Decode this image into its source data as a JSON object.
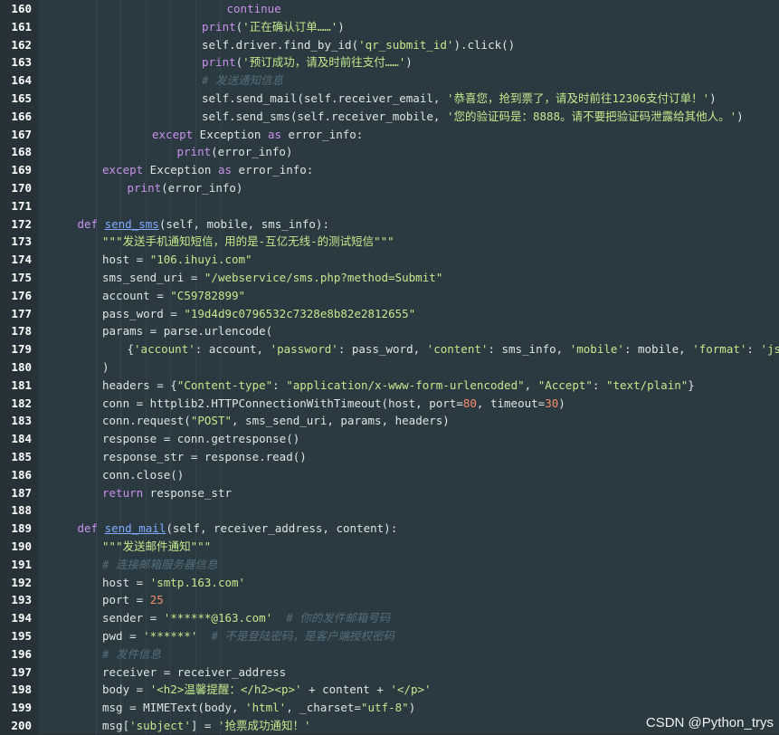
{
  "watermark": "CSDN @Python_trys",
  "lines": [
    {
      "n": "160",
      "indent": 7,
      "tokens": [
        [
          "kw",
          "continue"
        ]
      ]
    },
    {
      "n": "161",
      "indent": 6,
      "tokens": [
        [
          "bi",
          "print"
        ],
        [
          "plain",
          "("
        ],
        [
          "str",
          "'正在确认订单……'"
        ],
        [
          "plain",
          ")"
        ]
      ]
    },
    {
      "n": "162",
      "indent": 6,
      "tokens": [
        [
          "plain",
          "self.driver.find_by_id("
        ],
        [
          "str",
          "'qr_submit_id'"
        ],
        [
          "plain",
          ").click()"
        ]
      ]
    },
    {
      "n": "163",
      "indent": 6,
      "tokens": [
        [
          "bi",
          "print"
        ],
        [
          "plain",
          "("
        ],
        [
          "str",
          "'预订成功，请及时前往支付……'"
        ],
        [
          "plain",
          ")"
        ]
      ]
    },
    {
      "n": "164",
      "indent": 6,
      "tokens": [
        [
          "com",
          "# 发送通知信息"
        ]
      ]
    },
    {
      "n": "165",
      "indent": 6,
      "tokens": [
        [
          "plain",
          "self.send_mail(self.receiver_email, "
        ],
        [
          "str",
          "'恭喜您，抢到票了，请及时前往12306支付订单！'"
        ],
        [
          "plain",
          ")"
        ]
      ]
    },
    {
      "n": "166",
      "indent": 6,
      "tokens": [
        [
          "plain",
          "self.send_sms(self.receiver_mobile, "
        ],
        [
          "str",
          "'您的验证码是：8888。请不要把验证码泄露给其他人。'"
        ],
        [
          "plain",
          ")"
        ]
      ]
    },
    {
      "n": "167",
      "indent": 4,
      "tokens": [
        [
          "kw",
          "except"
        ],
        [
          "plain",
          " Exception "
        ],
        [
          "kw",
          "as"
        ],
        [
          "plain",
          " error_info:"
        ]
      ]
    },
    {
      "n": "168",
      "indent": 5,
      "tokens": [
        [
          "bi",
          "print"
        ],
        [
          "plain",
          "(error_info)"
        ]
      ]
    },
    {
      "n": "169",
      "indent": 2,
      "tokens": [
        [
          "kw",
          "except"
        ],
        [
          "plain",
          " Exception "
        ],
        [
          "kw",
          "as"
        ],
        [
          "plain",
          " error_info:"
        ]
      ]
    },
    {
      "n": "170",
      "indent": 3,
      "tokens": [
        [
          "bi",
          "print"
        ],
        [
          "plain",
          "(error_info)"
        ]
      ]
    },
    {
      "n": "171",
      "indent": 0,
      "tokens": []
    },
    {
      "n": "172",
      "indent": 1,
      "tokens": [
        [
          "kw",
          "def"
        ],
        [
          "plain",
          " "
        ],
        [
          "fn",
          "send_sms"
        ],
        [
          "plain",
          "(self, mobile, sms_info):"
        ]
      ]
    },
    {
      "n": "173",
      "indent": 2,
      "tokens": [
        [
          "str",
          "\"\"\"发送手机通知短信，用的是-互亿无线-的测试短信\"\"\""
        ]
      ]
    },
    {
      "n": "174",
      "indent": 2,
      "tokens": [
        [
          "plain",
          "host = "
        ],
        [
          "str",
          "\"106.ihuyi.com\""
        ]
      ]
    },
    {
      "n": "175",
      "indent": 2,
      "tokens": [
        [
          "plain",
          "sms_send_uri = "
        ],
        [
          "str",
          "\"/webservice/sms.php?method=Submit\""
        ]
      ]
    },
    {
      "n": "176",
      "indent": 2,
      "tokens": [
        [
          "plain",
          "account = "
        ],
        [
          "str",
          "\"C59782899\""
        ]
      ]
    },
    {
      "n": "177",
      "indent": 2,
      "tokens": [
        [
          "plain",
          "pass_word = "
        ],
        [
          "str",
          "\"19d4d9c0796532c7328e8b82e2812655\""
        ]
      ]
    },
    {
      "n": "178",
      "indent": 2,
      "tokens": [
        [
          "plain",
          "params = parse.urlencode("
        ]
      ]
    },
    {
      "n": "179",
      "indent": 3,
      "tokens": [
        [
          "plain",
          "{"
        ],
        [
          "str",
          "'account'"
        ],
        [
          "plain",
          ": account, "
        ],
        [
          "str",
          "'password'"
        ],
        [
          "plain",
          ": pass_word, "
        ],
        [
          "str",
          "'content'"
        ],
        [
          "plain",
          ": sms_info, "
        ],
        [
          "str",
          "'mobile'"
        ],
        [
          "plain",
          ": mobile, "
        ],
        [
          "str",
          "'format'"
        ],
        [
          "plain",
          ": "
        ],
        [
          "str",
          "'json'"
        ],
        [
          "plain",
          "}"
        ]
      ]
    },
    {
      "n": "180",
      "indent": 2,
      "tokens": [
        [
          "plain",
          ")"
        ]
      ]
    },
    {
      "n": "181",
      "indent": 2,
      "tokens": [
        [
          "plain",
          "headers = {"
        ],
        [
          "str",
          "\"Content-type\""
        ],
        [
          "plain",
          ": "
        ],
        [
          "str",
          "\"application/x-www-form-urlencoded\""
        ],
        [
          "plain",
          ", "
        ],
        [
          "str",
          "\"Accept\""
        ],
        [
          "plain",
          ": "
        ],
        [
          "str",
          "\"text/plain\""
        ],
        [
          "plain",
          "}"
        ]
      ]
    },
    {
      "n": "182",
      "indent": 2,
      "tokens": [
        [
          "plain",
          "conn = httplib2.HTTPConnectionWithTimeout(host, port="
        ],
        [
          "num",
          "80"
        ],
        [
          "plain",
          ", timeout="
        ],
        [
          "num",
          "30"
        ],
        [
          "plain",
          ")"
        ]
      ]
    },
    {
      "n": "183",
      "indent": 2,
      "tokens": [
        [
          "plain",
          "conn.request("
        ],
        [
          "str",
          "\"POST\""
        ],
        [
          "plain",
          ", sms_send_uri, params, headers)"
        ]
      ]
    },
    {
      "n": "184",
      "indent": 2,
      "tokens": [
        [
          "plain",
          "response = conn.getresponse()"
        ]
      ]
    },
    {
      "n": "185",
      "indent": 2,
      "tokens": [
        [
          "plain",
          "response_str = response.read()"
        ]
      ]
    },
    {
      "n": "186",
      "indent": 2,
      "tokens": [
        [
          "plain",
          "conn.close()"
        ]
      ]
    },
    {
      "n": "187",
      "indent": 2,
      "tokens": [
        [
          "kw",
          "return"
        ],
        [
          "plain",
          " response_str"
        ]
      ]
    },
    {
      "n": "188",
      "indent": 0,
      "tokens": []
    },
    {
      "n": "189",
      "indent": 1,
      "tokens": [
        [
          "kw",
          "def"
        ],
        [
          "plain",
          " "
        ],
        [
          "fn",
          "send_mail"
        ],
        [
          "plain",
          "(self, receiver_address, content):"
        ]
      ]
    },
    {
      "n": "190",
      "indent": 2,
      "tokens": [
        [
          "str",
          "\"\"\"发送邮件通知\"\"\""
        ]
      ]
    },
    {
      "n": "191",
      "indent": 2,
      "tokens": [
        [
          "com",
          "# 连接邮箱服务器信息"
        ]
      ]
    },
    {
      "n": "192",
      "indent": 2,
      "tokens": [
        [
          "plain",
          "host = "
        ],
        [
          "str",
          "'smtp.163.com'"
        ]
      ]
    },
    {
      "n": "193",
      "indent": 2,
      "tokens": [
        [
          "plain",
          "port = "
        ],
        [
          "num",
          "25"
        ]
      ]
    },
    {
      "n": "194",
      "indent": 2,
      "tokens": [
        [
          "plain",
          "sender = "
        ],
        [
          "str",
          "'******@163.com'"
        ],
        [
          "plain",
          "  "
        ],
        [
          "com",
          "# 你的发件邮箱号码"
        ]
      ]
    },
    {
      "n": "195",
      "indent": 2,
      "tokens": [
        [
          "plain",
          "pwd = "
        ],
        [
          "str",
          "'******'"
        ],
        [
          "plain",
          "  "
        ],
        [
          "com",
          "# 不是登陆密码，是客户端授权密码"
        ]
      ]
    },
    {
      "n": "196",
      "indent": 2,
      "tokens": [
        [
          "com",
          "# 发件信息"
        ]
      ]
    },
    {
      "n": "197",
      "indent": 2,
      "tokens": [
        [
          "plain",
          "receiver = receiver_address"
        ]
      ]
    },
    {
      "n": "198",
      "indent": 2,
      "tokens": [
        [
          "plain",
          "body = "
        ],
        [
          "str",
          "'<h2>温馨提醒：</h2><p>'"
        ],
        [
          "plain",
          " + content + "
        ],
        [
          "str",
          "'</p>'"
        ]
      ]
    },
    {
      "n": "199",
      "indent": 2,
      "tokens": [
        [
          "plain",
          "msg = MIMEText(body, "
        ],
        [
          "str",
          "'html'"
        ],
        [
          "plain",
          ", _charset="
        ],
        [
          "str",
          "\"utf-8\""
        ],
        [
          "plain",
          ")"
        ]
      ]
    },
    {
      "n": "200",
      "indent": 2,
      "tokens": [
        [
          "plain",
          "msg["
        ],
        [
          "str",
          "'subject'"
        ],
        [
          "plain",
          "] = "
        ],
        [
          "str",
          "'抢票成功通知！'"
        ]
      ]
    }
  ]
}
